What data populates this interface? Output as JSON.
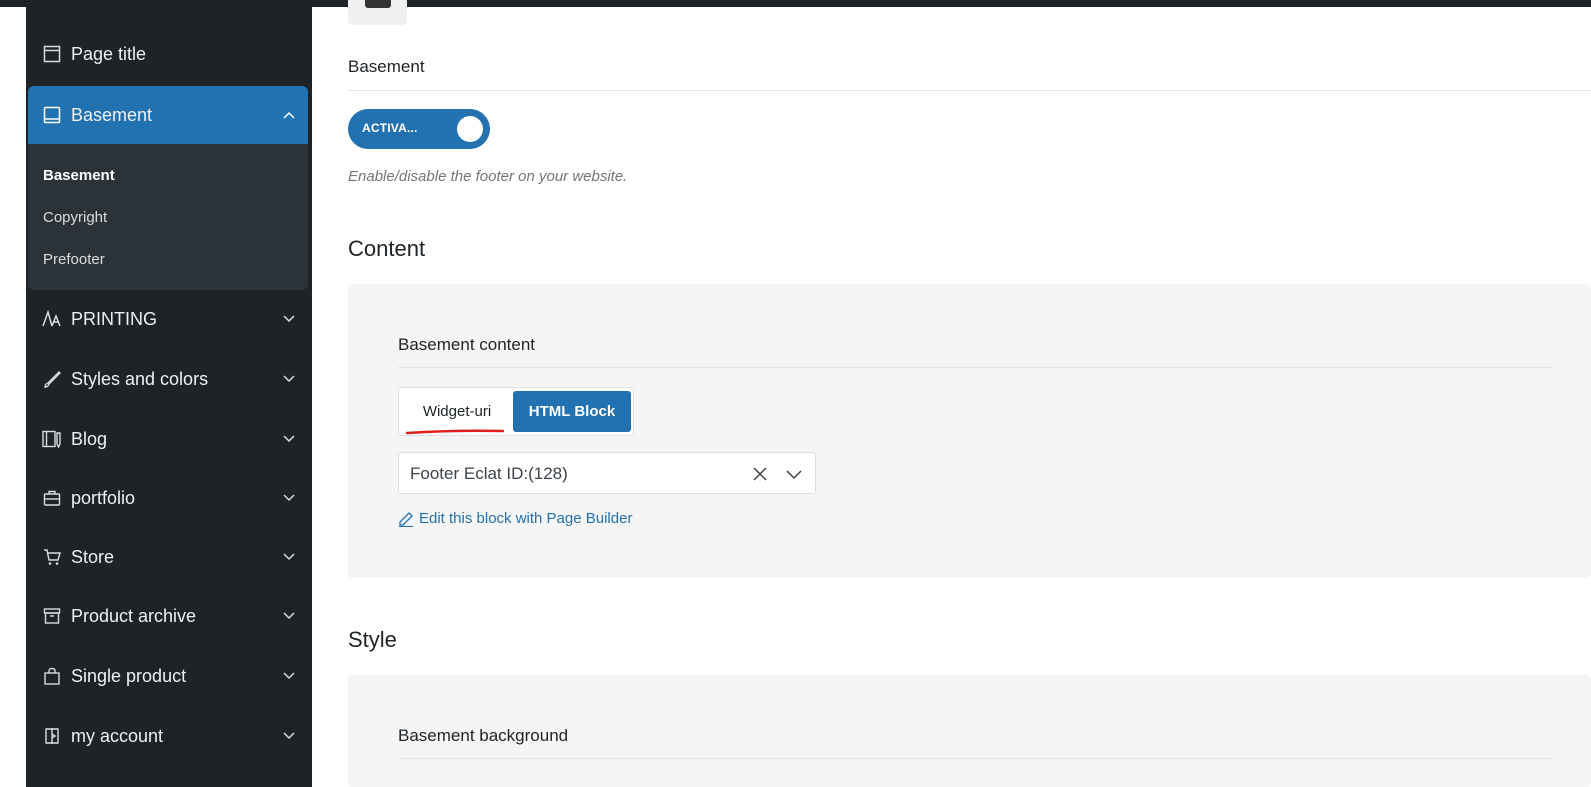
{
  "sidebar": {
    "items": [
      {
        "label": "Page title",
        "icon": "page-icon"
      },
      {
        "label": "Basement",
        "icon": "book-icon"
      },
      {
        "label": "PRINTING",
        "icon": "typography-icon"
      },
      {
        "label": "Styles and colors",
        "icon": "brush-icon"
      },
      {
        "label": "Blog",
        "icon": "blog-icon"
      },
      {
        "label": "portfolio",
        "icon": "briefcase-icon"
      },
      {
        "label": "Store",
        "icon": "cart-icon"
      },
      {
        "label": "Product archive",
        "icon": "archive-icon"
      },
      {
        "label": "Single product",
        "icon": "bag-icon"
      },
      {
        "label": "my account",
        "icon": "login-icon"
      }
    ],
    "submenu": [
      "Basement",
      "Copyright",
      "Prefooter"
    ],
    "active_color": "#2271b1"
  },
  "main": {
    "field_title": "Basement",
    "toggle_label": "ACTIVA...",
    "toggle_state": "on",
    "description": "Enable/disable the footer on your website.",
    "content_heading": "Content",
    "content_panel": {
      "title": "Basement content",
      "options": [
        "Widget-uri",
        "HTML Block"
      ],
      "selected_option": "HTML Block",
      "select_value": "Footer Eclat ID:(128)",
      "edit_link": "Edit this block with Page Builder"
    },
    "style_heading": "Style",
    "style_panel": {
      "title": "Basement background"
    }
  }
}
